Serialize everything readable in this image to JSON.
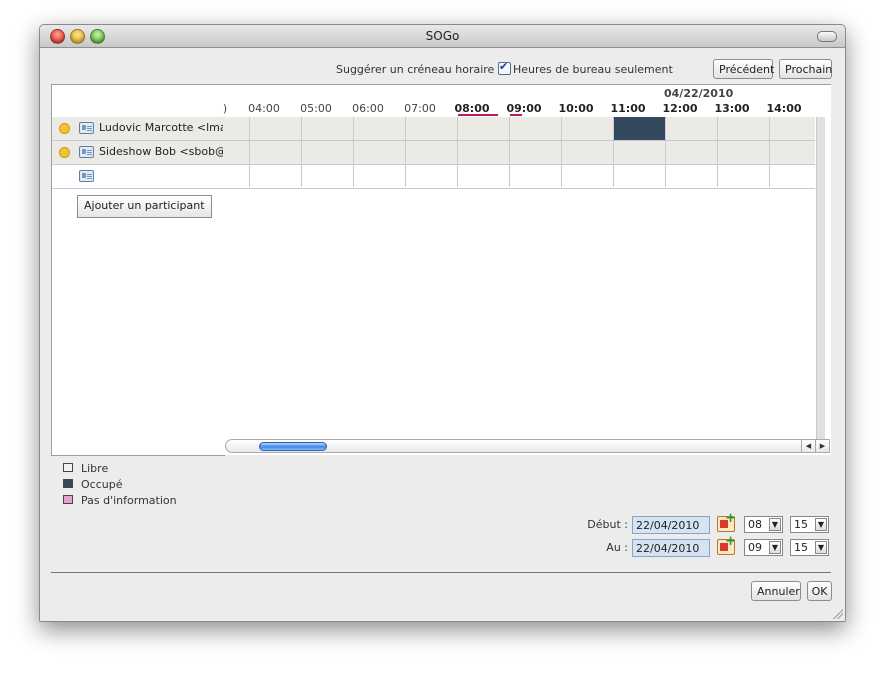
{
  "window": {
    "title": "SOGo"
  },
  "toolbar": {
    "suggest_label": "Suggérer un créneau horaire :",
    "office_hours_label": "Heures de bureau seulement",
    "office_hours_checked": true,
    "prev_label": "Précédent",
    "next_label": "Prochain"
  },
  "attendees": [
    {
      "name": "Ludovic Marcotte <lmar",
      "status_color": "#f4c430"
    },
    {
      "name": "Sideshow Bob <sbob@ir",
      "status_color": "#f4c430"
    }
  ],
  "add_attendee_label": "Ajouter un participant",
  "grid": {
    "date": "04/22/2010",
    "partial_hour": ")",
    "hours": [
      "04:00",
      "05:00",
      "06:00",
      "07:00",
      "08:00",
      "09:00",
      "10:00",
      "11:00",
      "12:00",
      "13:00",
      "14:00"
    ],
    "bold_hours": [
      "08:00",
      "09:00",
      "10:00",
      "11:00",
      "12:00",
      "13:00",
      "14:00"
    ],
    "selected_hours": [
      "08:00",
      "09:00"
    ],
    "busy": [
      {
        "attendee": 0,
        "hour": "11:00"
      }
    ]
  },
  "legend": [
    {
      "label": "Libre",
      "color": "#f2f2f2"
    },
    {
      "label": "Occupé",
      "color": "#34495e"
    },
    {
      "label": "Pas d'information",
      "color": "#e8a2c8"
    }
  ],
  "start": {
    "label": "Début :",
    "date": "22/04/2010",
    "hour": "08",
    "minute": "15"
  },
  "end": {
    "label": "Au :",
    "date": "22/04/2010",
    "hour": "09",
    "minute": "15"
  },
  "buttons": {
    "cancel": "Annuler",
    "ok": "OK"
  }
}
